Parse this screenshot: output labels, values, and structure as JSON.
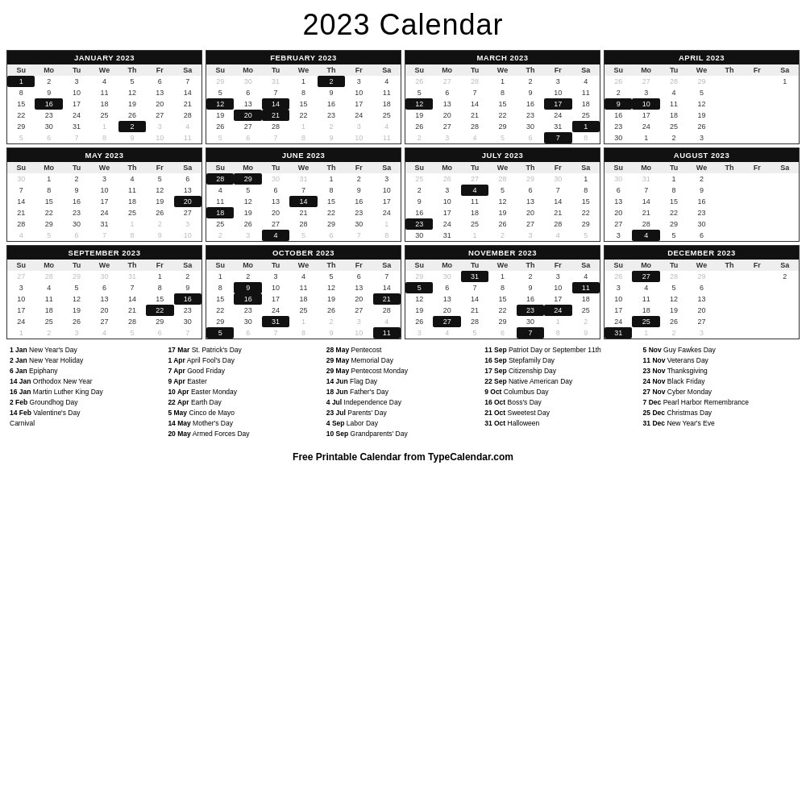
{
  "title": "2023 Calendar",
  "footer": "Free Printable Calendar from TypeCalendar.com",
  "months": [
    {
      "name": "JANUARY 2023",
      "days": [
        "Su",
        "Mo",
        "Tu",
        "We",
        "Th",
        "Fr",
        "Sa"
      ],
      "weeks": [
        [
          "1",
          "2",
          "3",
          "4",
          "5",
          "6",
          "7"
        ],
        [
          "8",
          "9",
          "10",
          "11",
          "12",
          "13",
          "14"
        ],
        [
          "15",
          "16",
          "17",
          "18",
          "19",
          "20",
          "21"
        ],
        [
          "22",
          "23",
          "24",
          "25",
          "26",
          "27",
          "28"
        ],
        [
          "29",
          "30",
          "31",
          "1",
          "2",
          "3",
          "4"
        ],
        [
          "5",
          "6",
          "7",
          "8",
          "9",
          "10",
          "11"
        ]
      ],
      "highlights": [
        "1",
        "16"
      ],
      "other_month_end": [
        "1",
        "2",
        "3",
        "4",
        "5",
        "6",
        "7",
        "8",
        "9",
        "10",
        "11"
      ],
      "show_partial": true,
      "partial_start_col": 3
    },
    {
      "name": "FEBRUARY 2023",
      "days": [
        "Su",
        "Mo",
        "Tu",
        "We",
        "Th",
        "Fr",
        "Sa"
      ],
      "weeks": [
        [
          "29",
          "30",
          "31",
          "1",
          "2",
          "3",
          "4"
        ],
        [
          "5",
          "6",
          "7",
          "8",
          "9",
          "10",
          "11"
        ],
        [
          "12",
          "13",
          "14",
          "15",
          "16",
          "17",
          "18"
        ],
        [
          "19",
          "20",
          "21",
          "22",
          "23",
          "24",
          "25"
        ],
        [
          "26",
          "27",
          "28",
          "1",
          "2",
          "3",
          "4"
        ],
        [
          "5",
          "6",
          "7",
          "8",
          "9",
          "10",
          "11"
        ]
      ],
      "highlights": [
        "2",
        "12",
        "14",
        "20",
        "21"
      ],
      "other_month_start": [
        "29",
        "30",
        "31"
      ],
      "other_month_end": [
        "1",
        "2",
        "3",
        "4",
        "5",
        "6",
        "7",
        "8",
        "9",
        "10",
        "11"
      ]
    },
    {
      "name": "MARCH 2023",
      "days": [
        "Su",
        "Mo",
        "Tu",
        "We",
        "Th",
        "Fr",
        "Sa"
      ],
      "weeks": [
        [
          "26",
          "27",
          "28",
          "1",
          "2",
          "3",
          "4"
        ],
        [
          "5",
          "6",
          "7",
          "8",
          "9",
          "10",
          "11"
        ],
        [
          "12",
          "13",
          "14",
          "15",
          "16",
          "17",
          "18"
        ],
        [
          "19",
          "20",
          "21",
          "22",
          "23",
          "24",
          "25"
        ],
        [
          "26",
          "27",
          "28",
          "29",
          "30",
          "31",
          "1"
        ],
        [
          "2",
          "3",
          "4",
          "5",
          "6",
          "7",
          "8"
        ]
      ],
      "highlights": [
        "12",
        "17",
        "1",
        "7"
      ],
      "other_month_start": [
        "26",
        "27",
        "28"
      ],
      "other_month_end": [
        "1",
        "2",
        "3",
        "4",
        "5",
        "6",
        "7",
        "8"
      ]
    },
    {
      "name": "APRIL 2023",
      "days": [
        "Su",
        "Mo",
        "Tu",
        "We"
      ],
      "partial": true
    },
    {
      "name": "MAY 2023",
      "days": [
        "Su",
        "Mo",
        "Tu",
        "We",
        "Th",
        "Fr",
        "Sa"
      ],
      "weeks": [
        [
          "30",
          "1",
          "2",
          "3",
          "4",
          "5",
          "6"
        ],
        [
          "7",
          "8",
          "9",
          "10",
          "11",
          "12",
          "13"
        ],
        [
          "14",
          "15",
          "16",
          "17",
          "18",
          "19",
          "20"
        ],
        [
          "21",
          "22",
          "23",
          "24",
          "25",
          "26",
          "27"
        ],
        [
          "28",
          "29",
          "30",
          "31",
          "1",
          "2",
          "3"
        ],
        [
          "4",
          "5",
          "6",
          "7",
          "8",
          "9",
          "10"
        ]
      ],
      "highlights": [
        "5",
        "14",
        "29"
      ],
      "other_month_start": [
        "30"
      ],
      "other_month_end": [
        "1",
        "2",
        "3",
        "4",
        "5",
        "6",
        "7",
        "8",
        "9",
        "10"
      ]
    },
    {
      "name": "JUNE 2023",
      "days": [
        "Su",
        "Mo",
        "Tu",
        "We",
        "Th",
        "Fr",
        "Sa"
      ],
      "weeks": [
        [
          "28",
          "29",
          "30",
          "31",
          "1",
          "2",
          "3"
        ],
        [
          "4",
          "5",
          "6",
          "7",
          "8",
          "9",
          "10"
        ],
        [
          "11",
          "12",
          "13",
          "14",
          "15",
          "16",
          "17"
        ],
        [
          "18",
          "19",
          "20",
          "21",
          "22",
          "23",
          "24"
        ],
        [
          "25",
          "26",
          "27",
          "28",
          "29",
          "30",
          "1"
        ],
        [
          "2",
          "3",
          "4",
          "5",
          "6",
          "7",
          "8"
        ]
      ],
      "highlights": [
        "18",
        "14",
        "4"
      ],
      "other_month_start": [
        "28",
        "29",
        "30",
        "31"
      ],
      "other_month_end": [
        "1",
        "2",
        "3",
        "4",
        "5",
        "6",
        "7",
        "8"
      ]
    },
    {
      "name": "JULY 2023",
      "days": [
        "Su",
        "Mo",
        "Tu",
        "We",
        "Th",
        "Fr",
        "Sa"
      ],
      "weeks": [
        [
          "25",
          "26",
          "27",
          "28",
          "29",
          "30",
          "1"
        ],
        [
          "2",
          "3",
          "4",
          "5",
          "6",
          "7",
          "8"
        ],
        [
          "9",
          "10",
          "11",
          "12",
          "13",
          "14",
          "15"
        ],
        [
          "16",
          "17",
          "18",
          "19",
          "20",
          "21",
          "22"
        ],
        [
          "23",
          "24",
          "25",
          "26",
          "27",
          "28",
          "29"
        ],
        [
          "30",
          "31",
          "1",
          "2",
          "3",
          "4",
          "5"
        ]
      ],
      "highlights": [
        "4",
        "23"
      ],
      "other_month_start": [
        "25",
        "26",
        "27",
        "28",
        "29",
        "30"
      ],
      "other_month_end": [
        "1",
        "2",
        "3",
        "4",
        "5"
      ]
    },
    {
      "name": "AUGUST 2023",
      "days": [
        "Su",
        "Mo",
        "Tu",
        "We"
      ],
      "partial": true
    },
    {
      "name": "SEPTEMBER 2023",
      "days": [
        "Su",
        "Mo",
        "Tu",
        "We",
        "Th",
        "Fr",
        "Sa"
      ],
      "weeks": [
        [
          "27",
          "28",
          "29",
          "30",
          "31",
          "1",
          "2"
        ],
        [
          "3",
          "4",
          "5",
          "6",
          "7",
          "8",
          "9"
        ],
        [
          "10",
          "11",
          "12",
          "13",
          "14",
          "15",
          "16"
        ],
        [
          "17",
          "18",
          "19",
          "20",
          "21",
          "22",
          "23"
        ],
        [
          "24",
          "25",
          "26",
          "27",
          "28",
          "29",
          "30"
        ],
        [
          "1",
          "2",
          "3",
          "4",
          "5",
          "6",
          "7"
        ]
      ],
      "highlights": [
        "4",
        "16",
        "22"
      ],
      "other_month_start": [
        "27",
        "28",
        "29",
        "30",
        "31"
      ],
      "other_month_end": [
        "1",
        "2",
        "3",
        "4",
        "5",
        "6",
        "7"
      ]
    },
    {
      "name": "OCTOBER 2023",
      "days": [
        "Su",
        "Mo",
        "Tu",
        "We",
        "Th",
        "Fr",
        "Sa"
      ],
      "weeks": [
        [
          "1",
          "2",
          "3",
          "4",
          "5",
          "6",
          "7"
        ],
        [
          "8",
          "9",
          "10",
          "11",
          "12",
          "13",
          "14"
        ],
        [
          "15",
          "16",
          "17",
          "18",
          "19",
          "20",
          "21"
        ],
        [
          "22",
          "23",
          "24",
          "25",
          "26",
          "27",
          "28"
        ],
        [
          "29",
          "30",
          "31",
          "1",
          "2",
          "3",
          "4"
        ],
        [
          "5",
          "6",
          "7",
          "8",
          "9",
          "10",
          "11"
        ]
      ],
      "highlights": [
        "9",
        "16",
        "31",
        "5",
        "11"
      ],
      "other_month_end": [
        "1",
        "2",
        "3",
        "4",
        "5",
        "6",
        "7",
        "8",
        "9",
        "10",
        "11"
      ]
    },
    {
      "name": "NOVEMBER 2023",
      "days": [
        "Su",
        "Mo",
        "Tu",
        "We",
        "Th",
        "Fr",
        "Sa"
      ],
      "weeks": [
        [
          "29",
          "30",
          "31",
          "1",
          "2",
          "3",
          "4"
        ],
        [
          "5",
          "6",
          "7",
          "8",
          "9",
          "10",
          "11"
        ],
        [
          "12",
          "13",
          "14",
          "15",
          "16",
          "17",
          "18"
        ],
        [
          "19",
          "20",
          "21",
          "22",
          "23",
          "24",
          "25"
        ],
        [
          "26",
          "27",
          "28",
          "29",
          "30",
          "1",
          "2"
        ],
        [
          "3",
          "4",
          "5",
          "6",
          "7",
          "8",
          "9"
        ]
      ],
      "highlights": [
        "31",
        "11",
        "23",
        "24",
        "27"
      ],
      "other_month_start": [
        "29",
        "30",
        "31"
      ],
      "other_month_end": [
        "1",
        "2",
        "3",
        "4",
        "5",
        "6",
        "7",
        "8",
        "9"
      ]
    },
    {
      "name": "DECEMBER 2023",
      "days": [
        "Su",
        "Mo",
        "Tu",
        "We"
      ],
      "partial": true
    }
  ],
  "holiday_columns": [
    {
      "items": [
        "1 Jan New Year's Day",
        "2 Jan New Year Holiday",
        "6 Jan Epiphany",
        "14 Jan Orthodox New Year",
        "16 Jan Martin Luther King Day",
        "2 Feb Groundhog Day",
        "14 Feb Valentine's Day",
        "Carnival"
      ]
    },
    {
      "items": [
        "17 Mar St. Patrick's Day",
        "1 Apr April Fool's Day",
        "7 Apr Good Friday",
        "9 Apr Easter",
        "10 Apr Easter Monday",
        "22 Apr Earth Day",
        "5 May Cinco de Mayo",
        "14 May Mother's Day",
        "20 May Armed Forces Day"
      ]
    },
    {
      "items": [
        "28 May Pentecost",
        "29 May Memorial Day",
        "29 May Pentecost Monday",
        "14 Jun Flag Day",
        "18 Jun Father's Day",
        "4 Jul Independence Day",
        "23 Jul Parents' Day",
        "4 Sep Labor Day",
        "10 Sep Grandparents' Day"
      ]
    },
    {
      "items": [
        "11 Sep Patriot Day or September 11th",
        "16 Sep Stepfamily Day",
        "17 Sep Citizenship Day",
        "22 Sep Native American Day",
        "9 Oct Columbus Day",
        "16 Oct Boss's Day",
        "21 Oct Sweetest Day",
        "31 Oct Halloween"
      ]
    },
    {
      "items": [
        "5 Nov Guy Fawkes Day",
        "11 Nov Veterans Day",
        "23 Nov Thanksgiving",
        "24 Nov Black Friday",
        "27 Nov Cyber Monday",
        "7 Dec Pearl Harbor",
        "Remember...",
        "25 Dec Christmas Day",
        "31 Dec New Year's Eve"
      ]
    }
  ]
}
